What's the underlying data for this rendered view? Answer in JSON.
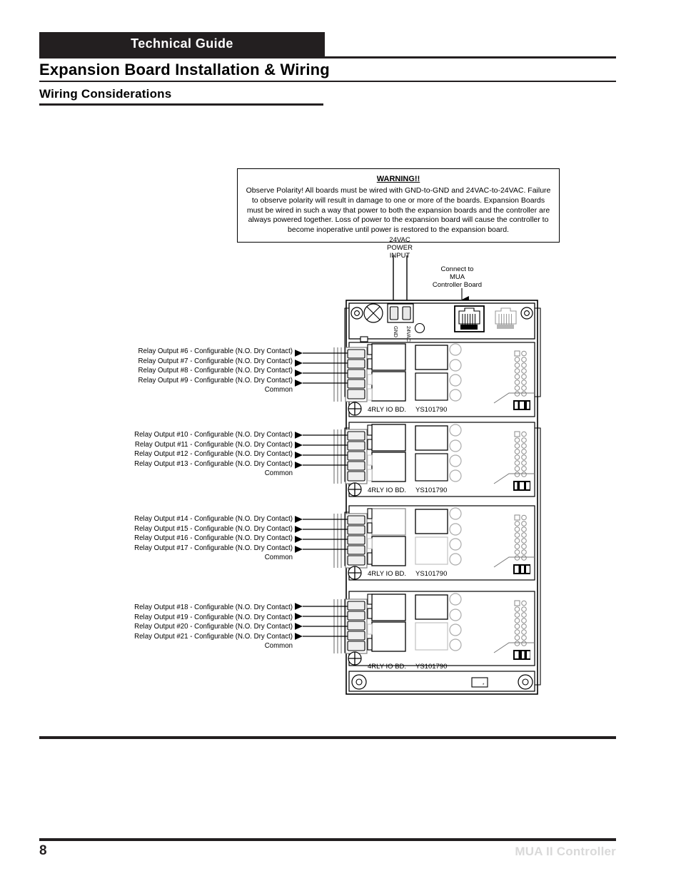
{
  "header": {
    "band_label": "Technical Guide",
    "page_title": "Expansion Board Installation & Wiring",
    "section_title": "Wiring Considerations"
  },
  "warning": {
    "title": "WARNING!!",
    "body": "Observe Polarity! All boards must be wired with GND-to-GND and 24VAC-to-24VAC. Failure to observe polarity will result in damage to one or more of the boards. Expansion Boards must be wired in such a way that power to both the expansion boards and the controller are always powered together. Loss of power to the expansion board will cause the controller to become inoperative until power is restored to the expansion board."
  },
  "callouts": {
    "power_input": "24VAC\nPOWER\nINPUT",
    "power_input_lines": [
      "24VAC",
      "POWER",
      "INPUT"
    ],
    "mua_connect_lines": [
      "Connect to",
      "MUA",
      "Controller Board"
    ]
  },
  "terminal_labels": {
    "gnd": "GND",
    "vac": "24VAC"
  },
  "board_silk": {
    "designation": "4RLY  IO BD.",
    "part_number": "YS101790"
  },
  "common_label": "Common",
  "relay_groups": [
    {
      "id": "board-1",
      "labels": [
        "Relay Output  #6 - Configurable (N.O. Dry Contact)",
        "Relay Output  #7 - Configurable (N.O. Dry Contact)",
        "Relay Output  #8 - Configurable (N.O. Dry Contact)",
        "Relay Output  #9 - Configurable (N.O. Dry Contact)"
      ],
      "common": "Common"
    },
    {
      "id": "board-2",
      "labels": [
        "Relay Output  #10 - Configurable (N.O. Dry Contact)",
        "Relay Output  #11 - Configurable (N.O. Dry Contact)",
        "Relay Output  #12 - Configurable (N.O. Dry Contact)",
        "Relay Output  #13 - Configurable (N.O. Dry Contact)"
      ],
      "common": "Common"
    },
    {
      "id": "board-3",
      "labels": [
        "Relay Output  #14 - Configurable (N.O. Dry Contact)",
        "Relay Output  #15 - Configurable (N.O. Dry Contact)",
        "Relay Output  #16 - Configurable (N.O. Dry Contact)",
        "Relay Output  #17 - Configurable (N.O. Dry Contact)"
      ],
      "common": "Common"
    },
    {
      "id": "board-4",
      "labels": [
        "Relay Output  #18 - Configurable (N.O. Dry Contact)",
        "Relay Output  #19 - Configurable (N.O. Dry Contact)",
        "Relay Output  #20 - Configurable (N.O. Dry Contact)",
        "Relay Output  #21 - Configurable (N.O. Dry Contact)"
      ],
      "common": "Common"
    }
  ],
  "footer": {
    "page_number": "8",
    "document_title": "MUA II Controller"
  },
  "colors": {
    "ink": "#231f20",
    "footer_title": "#d9d9d9",
    "board_line": "#000000",
    "board_fill": "#ffffff",
    "panel_gray": "#f2f2f2"
  }
}
